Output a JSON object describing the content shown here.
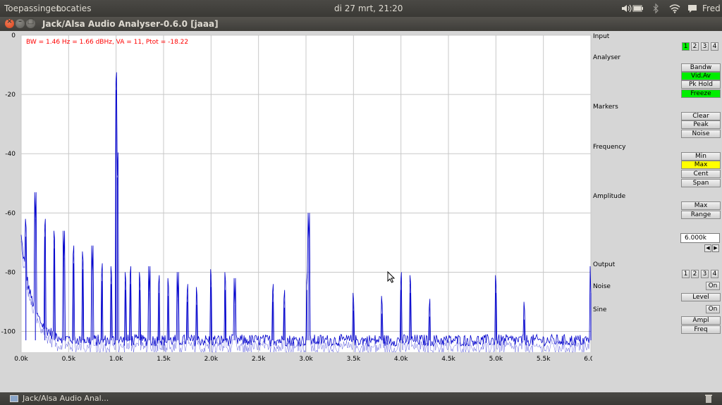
{
  "top_panel": {
    "menu_apps": "Toepassingen",
    "menu_places": "Locaties",
    "clock": "di 27 mrt, 21:20",
    "user": "Fred",
    "icons": [
      "volume-icon",
      "battery-icon",
      "bluetooth-icon",
      "wifi-icon",
      "chat-bubble-icon"
    ]
  },
  "window": {
    "title": "Jack/Alsa Audio Analyser-0.6.0  [jaaa]"
  },
  "plot": {
    "info": "BW = 1.46 Hz =  1.66 dBHz, VA = 11, Ptot = -18.22",
    "info_color": "#ff0000",
    "trace_color": "#0000cc"
  },
  "chart_data": {
    "type": "line",
    "title": "",
    "xlabel": "",
    "ylabel": "",
    "xlim": [
      0,
      6000
    ],
    "ylim": [
      -107,
      0
    ],
    "x_ticks": [
      "0.0k",
      "0.5k",
      "1.0k",
      "1.5k",
      "2.0k",
      "2.5k",
      "3.0k",
      "3.5k",
      "4.0k",
      "4.5k",
      "5.0k",
      "5.5k",
      "6.0k"
    ],
    "y_ticks": [
      "0",
      "-20",
      "-40",
      "-60",
      "-80",
      "-100"
    ],
    "grid": true,
    "noise_floor_db": -103,
    "peaks": [
      {
        "x": 1000,
        "y": -18.5
      },
      {
        "x": 1013,
        "y": -48
      },
      {
        "x": 3030,
        "y": -69
      },
      {
        "x": 3010,
        "y": -86
      },
      {
        "x": 150,
        "y": -62
      },
      {
        "x": 50,
        "y": -68
      },
      {
        "x": 250,
        "y": -68
      },
      {
        "x": 350,
        "y": -72
      },
      {
        "x": 450,
        "y": -75
      },
      {
        "x": 550,
        "y": -77
      },
      {
        "x": 650,
        "y": -79
      },
      {
        "x": 750,
        "y": -80
      },
      {
        "x": 850,
        "y": -83
      },
      {
        "x": 950,
        "y": -84
      },
      {
        "x": 1100,
        "y": -86
      },
      {
        "x": 1150,
        "y": -84
      },
      {
        "x": 1250,
        "y": -86
      },
      {
        "x": 1350,
        "y": -87
      },
      {
        "x": 1450,
        "y": -87
      },
      {
        "x": 1550,
        "y": -88
      },
      {
        "x": 1650,
        "y": -89
      },
      {
        "x": 1750,
        "y": -90
      },
      {
        "x": 1850,
        "y": -91
      },
      {
        "x": 2000,
        "y": -85
      },
      {
        "x": 2150,
        "y": -86
      },
      {
        "x": 2250,
        "y": -91
      },
      {
        "x": 2650,
        "y": -90
      },
      {
        "x": 2770,
        "y": -92
      },
      {
        "x": 3500,
        "y": -93
      },
      {
        "x": 3800,
        "y": -94
      },
      {
        "x": 4000,
        "y": -86
      },
      {
        "x": 4100,
        "y": -87
      },
      {
        "x": 4300,
        "y": -95
      },
      {
        "x": 5000,
        "y": -87
      },
      {
        "x": 5300,
        "y": -96
      },
      {
        "x": 6000,
        "y": -87
      }
    ]
  },
  "panel": {
    "input": {
      "label": "Input",
      "channels": [
        "1",
        "2",
        "3",
        "4"
      ],
      "active": "1"
    },
    "analyser": {
      "label": "Analyser",
      "buttons": [
        "Bandw",
        "Vid.Av",
        "Pk Hold",
        "Freeze"
      ],
      "active": [
        "Vid.Av",
        "Freeze"
      ]
    },
    "markers": {
      "label": "Markers",
      "buttons": [
        "Clear",
        "Peak",
        "Noise"
      ]
    },
    "frequency": {
      "label": "Frequency",
      "buttons": [
        "Min",
        "Max",
        "Cent",
        "Span"
      ],
      "selected": "Max"
    },
    "amplitude": {
      "label": "Amplitude",
      "buttons": [
        "Max",
        "Range"
      ]
    },
    "value_field": "6.000k",
    "output": {
      "label": "Output",
      "channels": [
        "1",
        "2",
        "3",
        "4"
      ]
    },
    "noise": {
      "label": "Noise",
      "toggle": "On",
      "level": "Level"
    },
    "sine": {
      "label": "Sine",
      "toggle": "On",
      "ampl": "Ampl",
      "freq": "Freq"
    },
    "accent_green": "#00ee00",
    "accent_yellow": "#ffff00"
  },
  "taskbar": {
    "item_label": "Jack/Alsa Audio Anal..."
  }
}
